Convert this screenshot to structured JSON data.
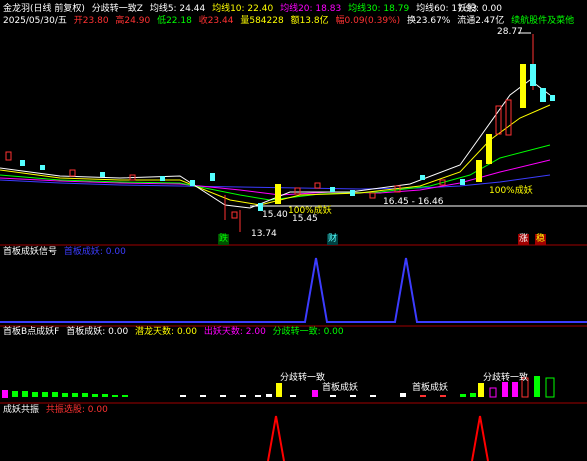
{
  "main": {
    "title": "金龙羽(日线 前复权)",
    "indicator_name": "分歧转一致Z",
    "ma5": "均线5: 24.44",
    "ma10": "均线10: 22.40",
    "ma20": "均线20: 18.83",
    "ma30": "均线30: 18.79",
    "ma60": "均线60: 17.93",
    "yao_label": "妖股: 0.00",
    "date": "2025/05/30/五",
    "open": "开23.80",
    "high": "高24.90",
    "low": "低22.18",
    "close": "收23.44",
    "extra1": "量584228",
    "amount": "额13.8亿",
    "change": "幅0.09(0.39%)",
    "turnover": "换23.67%",
    "float_cap": "流通2.47亿",
    "formula_hint": "续航股件及菜他",
    "price_high": "28.77",
    "low_price": "13.74",
    "annot_a": "15.40",
    "annot_a2": "100%成妖",
    "annot_b": "15.45",
    "annot_range": "16.45 - 16.46",
    "annot_c": "100%成妖",
    "tag1": "跌",
    "tag2": "财",
    "tag3": "涨",
    "tag4": "稳",
    "colors": {
      "up": "#ff3232",
      "down": "#54ffff",
      "yellow": "#ffff00",
      "bg": "#000000"
    }
  },
  "panel1": {
    "name": "首板成妖信号",
    "field": "首板成妖: 0.00"
  },
  "panel2": {
    "name": "首板B点成妖F",
    "f1": "首板成妖: 0.00",
    "f2": "潜龙天数: 0.00",
    "f3": "出妖天数: 2.00",
    "f4": "分歧转一致: 0.00",
    "label_a": "分歧转一致",
    "label_b": "首板成妖",
    "label_c": "首板成妖",
    "label_d": "分歧转一致"
  },
  "panel3": {
    "name": "成妖共振",
    "field": "共振选股: 0.00"
  }
}
